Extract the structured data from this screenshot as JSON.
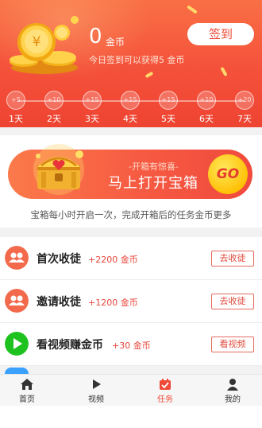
{
  "header": {
    "coin_count": "0",
    "coin_unit": "金币",
    "today_text": "今日签到可以获得5 金币",
    "checkin_label": "签到"
  },
  "checkin_days": [
    {
      "reward": "+5",
      "label": "1天"
    },
    {
      "reward": "+10",
      "label": "2天"
    },
    {
      "reward": "+15",
      "label": "3天"
    },
    {
      "reward": "+15",
      "label": "4天"
    },
    {
      "reward": "+15",
      "label": "5天"
    },
    {
      "reward": "+10",
      "label": "6天"
    },
    {
      "reward": "+20",
      "label": "7天"
    }
  ],
  "treasure": {
    "subtitle": "-开箱有惊喜-",
    "title": "马上打开宝箱",
    "go_label": "GO",
    "description": "宝箱每小时开启一次，完成开箱后的任务金币更多"
  },
  "tasks": [
    {
      "title": "首次收徒",
      "reward": "+2200 金币",
      "button": "去收徒",
      "icon": "people-icon",
      "icon_color": "#f26a4b"
    },
    {
      "title": "邀请收徒",
      "reward": "+1200 金币",
      "button": "去收徒",
      "icon": "people-icon",
      "icon_color": "#f26a4b"
    },
    {
      "title": "看视频赚金币",
      "reward": "+30 金币",
      "button": "看视频",
      "icon": "play-icon",
      "icon_color": "#1ec21e"
    }
  ],
  "nav": [
    {
      "label": "首页",
      "icon": "home-icon",
      "active": false
    },
    {
      "label": "视频",
      "icon": "play-icon",
      "active": false
    },
    {
      "label": "任务",
      "icon": "task-icon",
      "active": true
    },
    {
      "label": "我的",
      "icon": "user-icon",
      "active": false
    }
  ],
  "colors": {
    "accent": "#ef4a37",
    "header_top": "#f96f45",
    "header_bottom": "#ee4432",
    "gold": "#ffc107",
    "green": "#1ec21e"
  }
}
